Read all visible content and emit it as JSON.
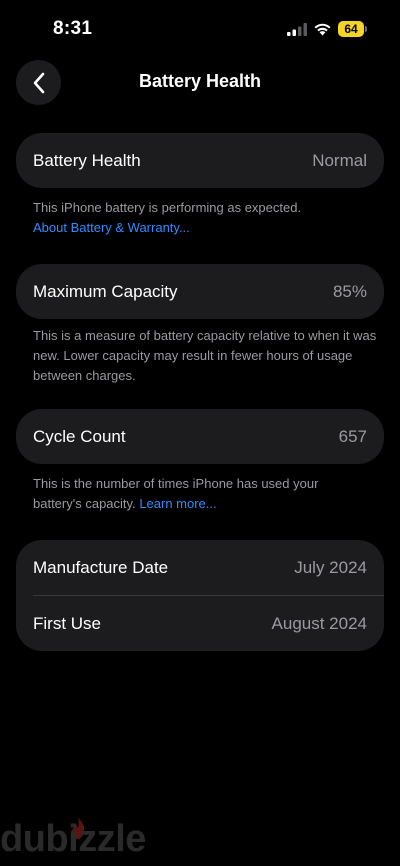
{
  "status_bar": {
    "time": "8:31",
    "battery_percent": "64",
    "battery_color": "#f5d327"
  },
  "nav": {
    "back_icon": "chevron-left-icon",
    "title": "Battery Health"
  },
  "battery_health": {
    "label": "Battery Health",
    "value": "Normal",
    "footnote": "This iPhone battery is performing as expected.",
    "link": "About Battery & Warranty..."
  },
  "maximum_capacity": {
    "label": "Maximum Capacity",
    "value": "85%",
    "footnote": "This is a measure of battery capacity relative to when it was new. Lower capacity may result in fewer hours of usage between charges."
  },
  "cycle_count": {
    "label": "Cycle Count",
    "value": "657",
    "footnote": "This is the number of times iPhone has used your battery's capacity.",
    "link": "Learn more..."
  },
  "dates": {
    "manufacture_label": "Manufacture Date",
    "manufacture_value": "July 2024",
    "first_use_label": "First Use",
    "first_use_value": "August 2024"
  },
  "watermark": {
    "text": "dubizzle"
  },
  "colors": {
    "link": "#2f8cff",
    "card_bg": "#1c1c1e",
    "secondary_text": "#9a9aa0"
  }
}
